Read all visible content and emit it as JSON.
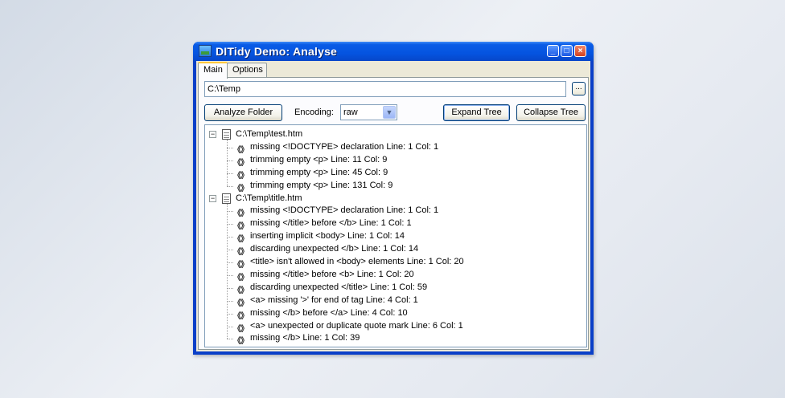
{
  "window": {
    "title": "DITidy Demo: Analyse"
  },
  "tabs": [
    {
      "label": "Main",
      "active": true
    },
    {
      "label": "Options",
      "active": false
    }
  ],
  "path_input": {
    "value": "C:\\Temp"
  },
  "browse_button": {
    "label": "..."
  },
  "analyze_button": {
    "label": "Analyze Folder"
  },
  "encoding": {
    "label": "Encoding:",
    "value": "raw"
  },
  "expand_button": {
    "label": "Expand Tree"
  },
  "collapse_button": {
    "label": "Collapse Tree"
  },
  "tree": {
    "files": [
      {
        "name": "C:\\Temp\\test.htm",
        "messages": [
          "missing <!DOCTYPE> declaration Line: 1 Col: 1",
          "trimming empty <p> Line: 11 Col: 9",
          "trimming empty <p> Line: 45 Col: 9",
          "trimming empty <p> Line: 131 Col: 9"
        ]
      },
      {
        "name": "C:\\Temp\\title.htm",
        "messages": [
          "missing <!DOCTYPE> declaration Line: 1 Col: 1",
          "missing </title> before </b> Line: 1 Col: 1",
          "inserting implicit <body> Line: 1 Col: 14",
          "discarding unexpected </b> Line: 1 Col: 14",
          "<title> isn't allowed in <body> elements Line: 1 Col: 20",
          "missing </title> before <b> Line: 1 Col: 20",
          "discarding unexpected </title> Line: 1 Col: 59",
          "<a> missing '>' for end of tag Line: 4 Col: 1",
          "missing </b> before </a> Line: 4 Col: 10",
          "<a> unexpected or duplicate quote mark Line: 6 Col: 1",
          "missing </b> Line: 1 Col: 39"
        ]
      }
    ]
  },
  "icons": {
    "message": "message-icon",
    "file": "document-icon",
    "collapse": "minus-expander-icon"
  },
  "colors": {
    "titlebar": "#0554e0",
    "close": "#d4411f",
    "client": "#ece9d8"
  }
}
